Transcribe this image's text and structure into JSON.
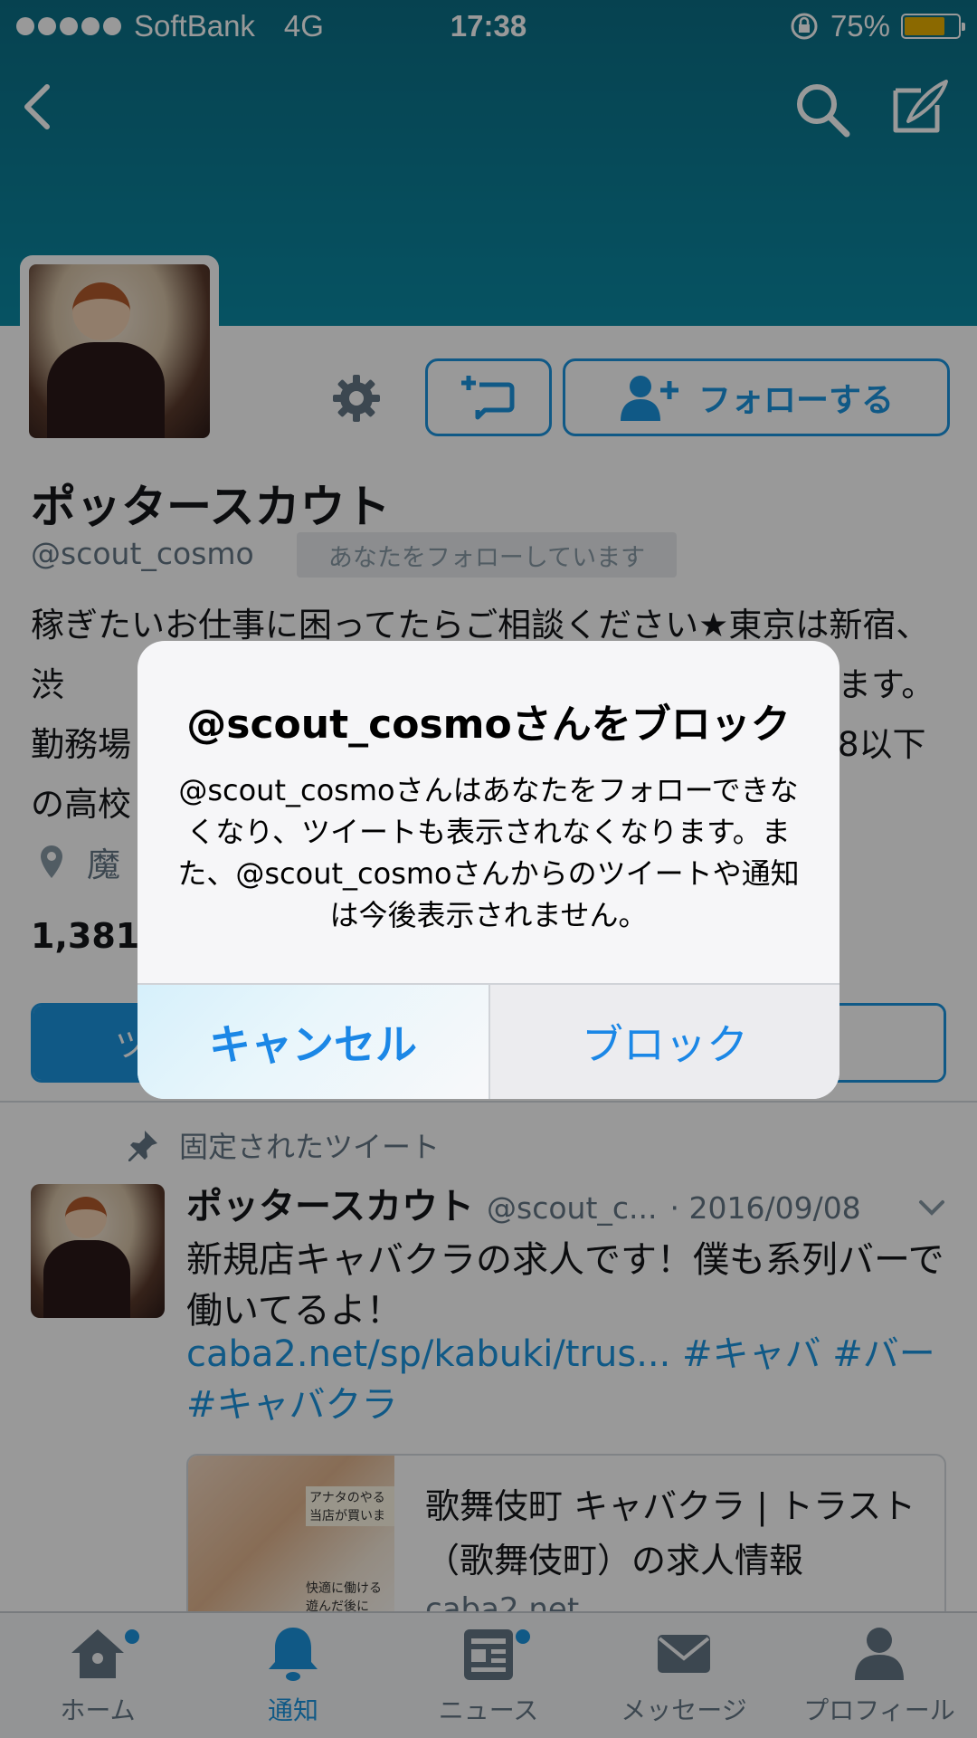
{
  "status_bar": {
    "carrier": "SoftBank",
    "network": "4G",
    "time": "17:38",
    "battery": "75%",
    "battery_level": 0.75
  },
  "header": {
    "icons": [
      "back-icon",
      "search-icon",
      "compose-icon"
    ],
    "color": "#0a7f98"
  },
  "profile": {
    "name": "ポッタースカウト",
    "handle": "@scout_cosmo",
    "follows_you": "あなたをフォローしています",
    "follow_button": "フォローする",
    "bio": "稼ぎたいお仕事に困ってたらご相談ください★東京は新宿、渋",
    "bio_right_1": "ます。",
    "bio_line3_left": "勤務場",
    "bio_line3_right": "8以下",
    "bio_line4_left": "の高校",
    "location": "魔",
    "count": "1,381",
    "tab_label": "ツ"
  },
  "pinned_tweet": {
    "pinned_label": "固定されたツイート",
    "name": "ポッタースカウト",
    "handle": "@scout_c...",
    "date": "· 2016/09/08",
    "text": "新規店キャバクラの求人です！僕も系列バーで働いてるよ！",
    "link_line1": "caba2.net/sp/kabuki/trus... #キャバ #バー",
    "link_line2": "#キャバクラ",
    "card_title": "歌舞伎町 キャバクラ | トラスト（歌舞伎町）の求人情報",
    "card_host": "caba2.net",
    "card_img_text_1": "アナタのやる 当店が買いま",
    "card_img_text_2": "快適に働ける 遊んだ後に"
  },
  "bottom_tabs": [
    {
      "label": "ホーム",
      "icon": "home-icon"
    },
    {
      "label": "通知",
      "icon": "bell-icon"
    },
    {
      "label": "ニュース",
      "icon": "news-icon"
    },
    {
      "label": "メッセージ",
      "icon": "envelope-icon"
    },
    {
      "label": "プロフィール",
      "icon": "person-icon"
    }
  ],
  "dialog": {
    "title": "@scout_cosmoさんをブロック",
    "message": "@scout_cosmoさんはあなたをフォローできなくなり、ツイートも表示されなくなります。また、@scout_cosmoさんからのツイートや通知は今後表示されません。",
    "cancel_label": "キャンセル",
    "block_label": "ブロック"
  },
  "colors": {
    "accent": "#1b95e0",
    "header": "#0a7f98"
  }
}
